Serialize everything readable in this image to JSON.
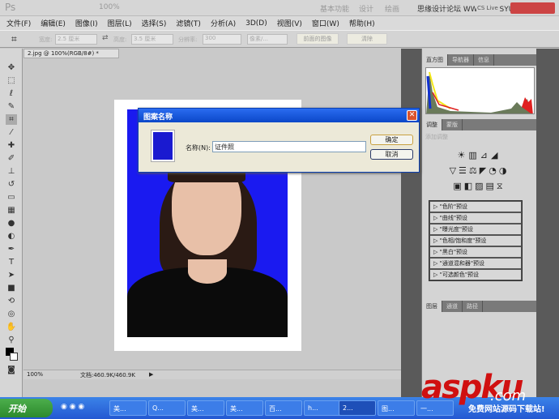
{
  "app": {
    "logo": "Ps",
    "zoom": "100%",
    "workspaces": [
      "基本功能",
      "设计",
      "绘画"
    ],
    "cs_live": "CS Live"
  },
  "watermark_top": "思缘设计论坛 WWW.MISSYUAN.COM",
  "menu": [
    "文件(F)",
    "编辑(E)",
    "图像(I)",
    "图层(L)",
    "选择(S)",
    "滤镜(T)",
    "分析(A)",
    "3D(D)",
    "视图(V)",
    "窗口(W)",
    "帮助(H)"
  ],
  "options": {
    "width_label": "宽度:",
    "width_value": "2.5 厘米",
    "height_label": "高度:",
    "height_value": "3.5 厘米",
    "res_label": "分辨率:",
    "res_value": "300",
    "unit": "像素/...",
    "front_image": "前面的图像",
    "clear": "清除"
  },
  "document": {
    "tab": "2.jpg @ 100%(RGB/8#) *",
    "zoom": "100%",
    "doc_info": "文档:460.9K/460.9K"
  },
  "dialog": {
    "title": "图案名称",
    "name_label": "名称(N):",
    "name_value": "证件照",
    "ok": "确定",
    "cancel": "取消"
  },
  "panels": {
    "top_tabs": [
      "直方图",
      "导航器",
      "信息"
    ],
    "adj_tabs": [
      "调整",
      "蒙版"
    ],
    "add_adjustment": "添加调整",
    "presets": [
      "\"色阶\"预设",
      "\"曲线\"预设",
      "\"曝光度\"预设",
      "\"色相/饱和度\"预设",
      "\"黑白\"预设",
      "\"通道混和器\"预设",
      "\"可选颜色\"预设"
    ],
    "bottom_tabs": [
      "图层",
      "通道",
      "路径"
    ]
  },
  "taskbar": {
    "start": "开始",
    "tasks": [
      "美...",
      "Q...",
      "美...",
      "美...",
      "百...",
      "h...",
      "2...",
      "图...",
      "一..."
    ]
  },
  "watermark": {
    "brand": "aspku",
    ".com": ".com",
    "slogan": "免费网站源码下载站!"
  }
}
